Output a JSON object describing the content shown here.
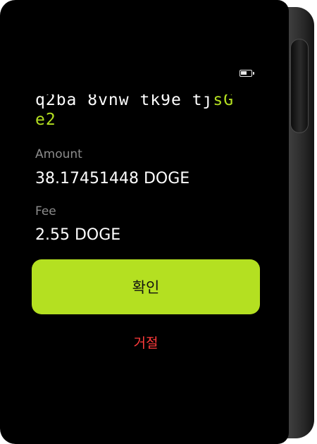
{
  "status_bar": {
    "battery_icon": "battery-icon"
  },
  "transaction": {
    "address_line1_plain": "q2ba 8vnw tk9e tj",
    "address_line1_highlight": "sG",
    "address_line2_highlight": "e2",
    "amount_label": "Amount",
    "amount_value": "38.17451448 DOGE",
    "fee_label": "Fee",
    "fee_value": "2.55 DOGE"
  },
  "actions": {
    "confirm_label": "확인",
    "reject_label": "거절"
  },
  "colors": {
    "accent": "#b4e021",
    "reject": "#ff3b3b",
    "screen": "#000000",
    "muted_label": "#8c8c8c"
  }
}
